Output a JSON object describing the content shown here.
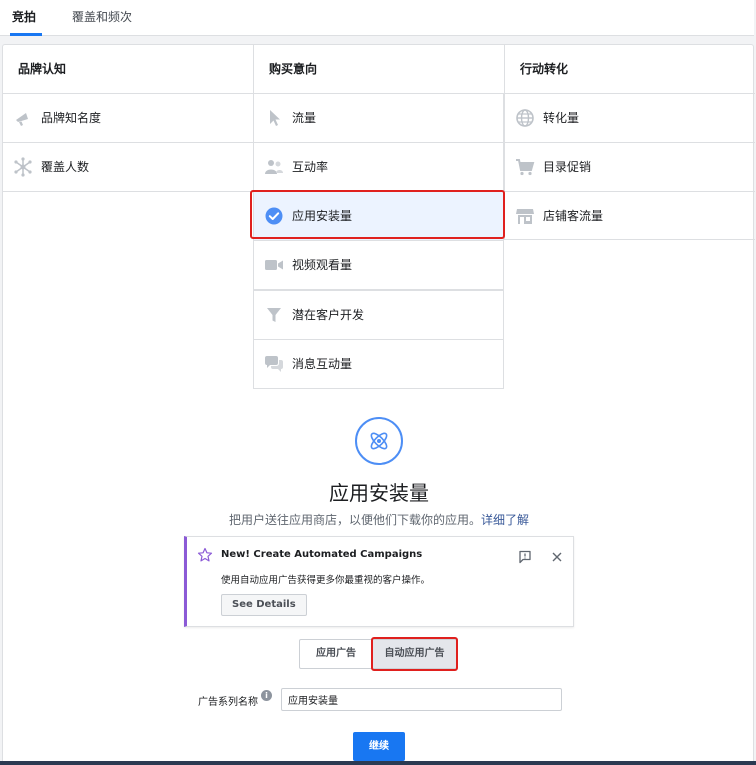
{
  "tabs": [
    {
      "label": "竞拍",
      "active": true
    },
    {
      "label": "覆盖和频次",
      "active": false
    }
  ],
  "columns": [
    {
      "header": "品牌认知",
      "items": [
        {
          "label": "品牌知名度",
          "icon": "megaphone-icon"
        },
        {
          "label": "覆盖人数",
          "icon": "network-icon"
        }
      ]
    },
    {
      "header": "购买意向",
      "items": [
        {
          "label": "流量",
          "icon": "cursor-icon"
        },
        {
          "label": "互动率",
          "icon": "people-icon"
        },
        {
          "label": "应用安装量",
          "icon": "checkmark-circle-icon",
          "selected": true
        },
        {
          "label": "视频观看量",
          "icon": "video-camera-icon"
        },
        {
          "label": "潜在客户开发",
          "icon": "funnel-icon"
        },
        {
          "label": "消息互动量",
          "icon": "chat-bubbles-icon"
        }
      ]
    },
    {
      "header": "行动转化",
      "items": [
        {
          "label": "转化量",
          "icon": "globe-icon"
        },
        {
          "label": "目录促销",
          "icon": "shopping-cart-icon"
        },
        {
          "label": "店铺客流量",
          "icon": "storefront-icon"
        }
      ]
    }
  ],
  "detail": {
    "icon": "atom-icon",
    "title": "应用安装量",
    "subtitle": "把用户送往应用商店，以便他们下载你的应用。",
    "learn_more": "详细了解"
  },
  "notice": {
    "icon": "star-icon",
    "title": "New! Create Automated Campaigns",
    "body": "使用自动应用广告获得更多你最重视的客户操作。",
    "button": "See Details",
    "feedback_icon": "feedback-flag-icon",
    "close_icon": "close-icon"
  },
  "ad_type": {
    "options": [
      "应用广告",
      "自动应用广告"
    ],
    "selected": "自动应用广告"
  },
  "campaign_name": {
    "label": "广告系列名称",
    "info_icon": "info-icon",
    "value": "应用安装量"
  },
  "continue_button": "继续",
  "colors": {
    "accent": "#1877f2",
    "highlight": "#e0201e",
    "selected_bg": "#ecf3ff",
    "notice_border": "#8b5ad6"
  }
}
